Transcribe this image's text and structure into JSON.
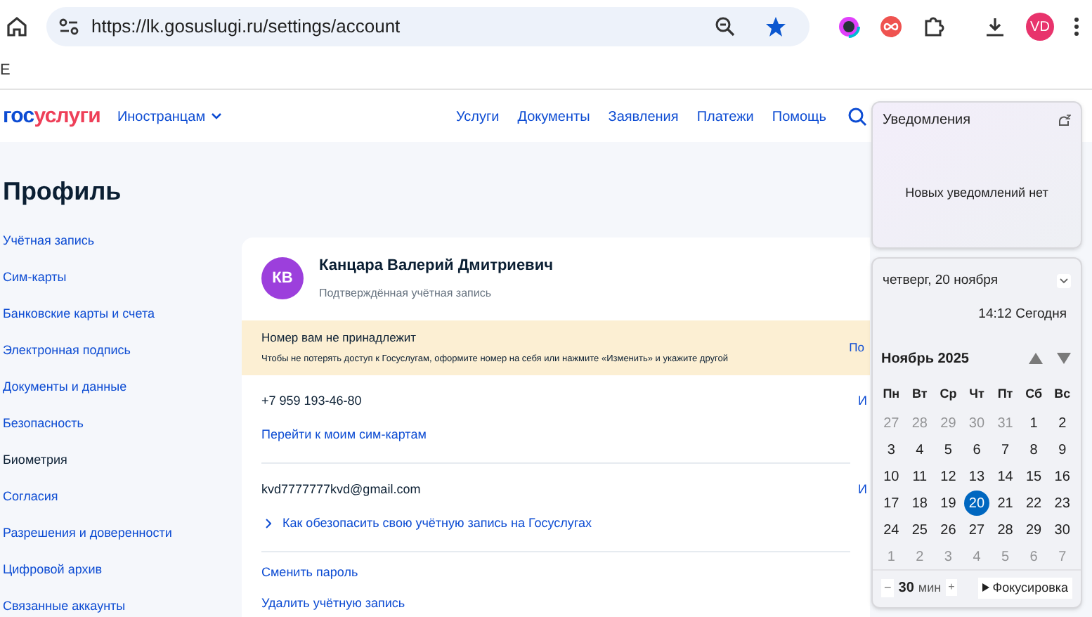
{
  "browser": {
    "url": "https://lk.gosuslugi.ru/settings/account",
    "profile_initials": "VD",
    "bookmark": "Е"
  },
  "header": {
    "logo": {
      "part_1": "гос",
      "part_2": "услуги"
    },
    "audience": "Иностранцам",
    "nav": [
      "Услуги",
      "Документы",
      "Заявления",
      "Платежи",
      "Помощь"
    ]
  },
  "page_title": "Профиль",
  "sidebar": {
    "items": [
      {
        "label": "Учётная запись",
        "selected": false
      },
      {
        "label": "Сим-карты",
        "selected": false
      },
      {
        "label": "Банковские карты и счета",
        "selected": false
      },
      {
        "label": "Электронная подпись",
        "selected": false
      },
      {
        "label": "Документы и данные",
        "selected": false
      },
      {
        "label": "Безопасность",
        "selected": false
      },
      {
        "label": "Биометрия",
        "selected": true
      },
      {
        "label": "Согласия",
        "selected": false
      },
      {
        "label": "Разрешения и доверенности",
        "selected": false
      },
      {
        "label": "Цифровой архив",
        "selected": false
      },
      {
        "label": "Связанные аккаунты",
        "selected": false
      }
    ]
  },
  "account": {
    "initials": "КВ",
    "name": "Канцара Валерий Дмитриевич",
    "status": "Подтверждённая учётная запись",
    "warning": {
      "title": "Номер вам не принадлежит",
      "text": "Чтобы не потерять доступ к Госуслугам, оформите номер на себя или нажмите «Изменить» и укажите другой",
      "action": "По"
    },
    "phone": {
      "value": "+7 959 193-46-80",
      "edit": "И",
      "link": "Перейти к моим сим-картам"
    },
    "email": {
      "value": "kvd7777777kvd@gmail.com",
      "edit": "И",
      "link": "Как обезопасить свою учётную запись на Госуслугах"
    },
    "actions": [
      "Сменить пароль",
      "Удалить учётную запись"
    ]
  },
  "notifications": {
    "title": "Уведомления",
    "empty": "Новых уведомлений нет"
  },
  "calendar": {
    "date": "четверг, 20 ноября",
    "time": "14:12 Сегодня",
    "month": "Ноябрь 2025",
    "weekdays": [
      "Пн",
      "Вт",
      "Ср",
      "Чт",
      "Пт",
      "Сб",
      "Вс"
    ],
    "weeks": [
      [
        {
          "day": "27",
          "muted": true,
          "selected": false
        },
        {
          "day": "28",
          "muted": true,
          "selected": false
        },
        {
          "day": "29",
          "muted": true,
          "selected": false
        },
        {
          "day": "30",
          "muted": true,
          "selected": false
        },
        {
          "day": "31",
          "muted": true,
          "selected": false
        },
        {
          "day": "1",
          "muted": false,
          "selected": false
        },
        {
          "day": "2",
          "muted": false,
          "selected": false
        }
      ],
      [
        {
          "day": "3",
          "muted": false,
          "selected": false
        },
        {
          "day": "4",
          "muted": false,
          "selected": false
        },
        {
          "day": "5",
          "muted": false,
          "selected": false
        },
        {
          "day": "6",
          "muted": false,
          "selected": false
        },
        {
          "day": "7",
          "muted": false,
          "selected": false
        },
        {
          "day": "8",
          "muted": false,
          "selected": false
        },
        {
          "day": "9",
          "muted": false,
          "selected": false
        }
      ],
      [
        {
          "day": "10",
          "muted": false,
          "selected": false
        },
        {
          "day": "11",
          "muted": false,
          "selected": false
        },
        {
          "day": "12",
          "muted": false,
          "selected": false
        },
        {
          "day": "13",
          "muted": false,
          "selected": false
        },
        {
          "day": "14",
          "muted": false,
          "selected": false
        },
        {
          "day": "15",
          "muted": false,
          "selected": false
        },
        {
          "day": "16",
          "muted": false,
          "selected": false
        }
      ],
      [
        {
          "day": "17",
          "muted": false,
          "selected": false
        },
        {
          "day": "18",
          "muted": false,
          "selected": false
        },
        {
          "day": "19",
          "muted": false,
          "selected": false
        },
        {
          "day": "20",
          "muted": false,
          "selected": true
        },
        {
          "day": "21",
          "muted": false,
          "selected": false
        },
        {
          "day": "22",
          "muted": false,
          "selected": false
        },
        {
          "day": "23",
          "muted": false,
          "selected": false
        }
      ],
      [
        {
          "day": "24",
          "muted": false,
          "selected": false
        },
        {
          "day": "25",
          "muted": false,
          "selected": false
        },
        {
          "day": "26",
          "muted": false,
          "selected": false
        },
        {
          "day": "27",
          "muted": false,
          "selected": false
        },
        {
          "day": "28",
          "muted": false,
          "selected": false
        },
        {
          "day": "29",
          "muted": false,
          "selected": false
        },
        {
          "day": "30",
          "muted": false,
          "selected": false
        }
      ],
      [
        {
          "day": "1",
          "muted": true,
          "selected": false
        },
        {
          "day": "2",
          "muted": true,
          "selected": false
        },
        {
          "day": "3",
          "muted": true,
          "selected": false
        },
        {
          "day": "4",
          "muted": true,
          "selected": false
        },
        {
          "day": "5",
          "muted": true,
          "selected": false
        },
        {
          "day": "6",
          "muted": true,
          "selected": false
        },
        {
          "day": "7",
          "muted": true,
          "selected": false
        }
      ]
    ],
    "focus": {
      "minus": "−",
      "minutes": "30",
      "unit": "мин",
      "plus": "+",
      "start": "Фокусировка"
    }
  }
}
